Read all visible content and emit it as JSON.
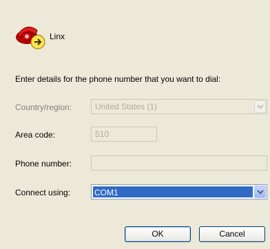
{
  "connection": {
    "name": "Linx",
    "icon": "phone-connection-icon"
  },
  "prompt": "Enter details for the phone number that you want to dial:",
  "fields": {
    "country": {
      "label": "Country/region:",
      "value": "United States (1)",
      "disabled": true
    },
    "area_code": {
      "label": "Area code:",
      "value": "510",
      "disabled": true
    },
    "phone_number": {
      "label": "Phone number:",
      "value": "",
      "disabled": true
    },
    "connect_using": {
      "label": "Connect using:",
      "value": "COM1"
    }
  },
  "buttons": {
    "ok": "OK",
    "cancel": "Cancel"
  },
  "colors": {
    "background": "#ece9d8",
    "selection": "#316ac5",
    "border": "#7f9db9",
    "disabled_text": "#acaba0"
  }
}
